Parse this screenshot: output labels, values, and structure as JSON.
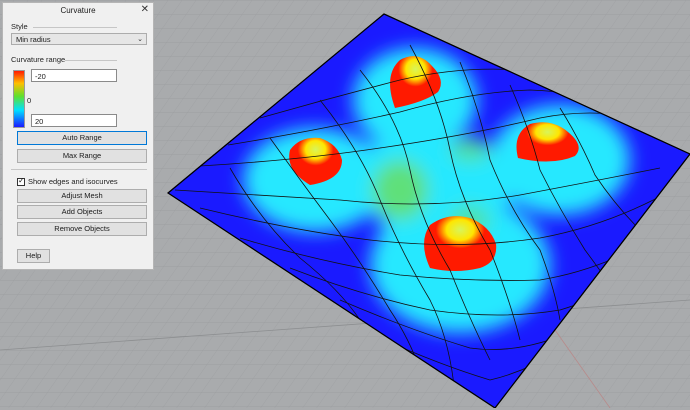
{
  "panel": {
    "title": "Curvature",
    "close_glyph": "✕",
    "style_label": "Style",
    "style_value": "Min radius",
    "range_label": "Curvature range",
    "min_value": "-20",
    "mid_value": "0",
    "max_value": "20",
    "auto_range_label": "Auto Range",
    "max_range_label": "Max Range",
    "show_edges_label": "Show edges and isocurves",
    "show_edges_checked": true,
    "adjust_mesh_label": "Adjust Mesh",
    "add_objects_label": "Add Objects",
    "remove_objects_label": "Remove Objects",
    "help_label": "Help",
    "icons": [
      "close-icon",
      "chevron-down-icon",
      "checkbox-check-icon"
    ]
  },
  "viewport": {
    "background": "#a9abad",
    "surface_base_color": "#1a1aff",
    "colors": {
      "red": "#ff1a00",
      "yellow": "#ffe600",
      "green": "#3fe03a",
      "cyan": "#00e6ff",
      "blue": "#1a1aff"
    },
    "bumps": 4
  }
}
